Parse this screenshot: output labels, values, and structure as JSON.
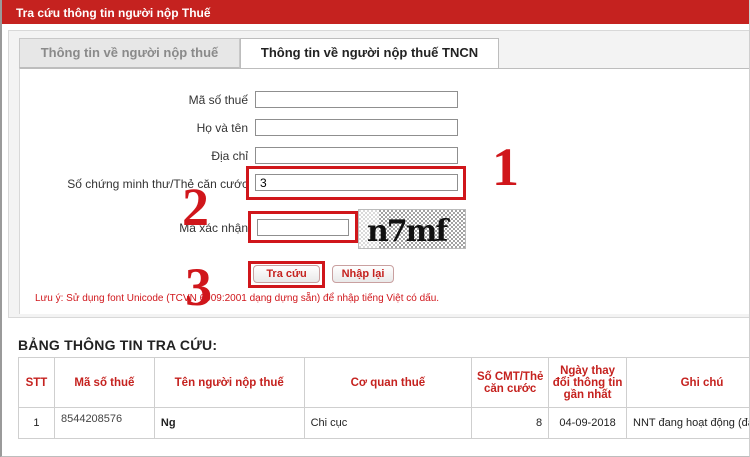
{
  "window": {
    "title": "Tra cứu thông tin người nộp Thuế"
  },
  "tabs": [
    {
      "label": "Thông tin về người nộp thuế"
    },
    {
      "label": "Thông tin về người nộp thuế TNCN"
    }
  ],
  "form": {
    "tax_code_label": "Mã số thuế",
    "tax_code_value": "",
    "name_label": "Họ và tên",
    "name_value": "",
    "address_label": "Địa chỉ",
    "address_value": "",
    "id_label": "Số chứng minh thư/Thẻ căn cước",
    "id_value": "3",
    "captcha_label": "Mã xác nhận",
    "captcha_value": "",
    "captcha_text": "n7mf",
    "search_button": "Tra cứu",
    "reset_button": "Nhập lại",
    "note": "Lưu ý: Sử dụng font Unicode (TCVN 6909:2001 dạng dựng sẵn) để nhập tiếng Việt có dấu."
  },
  "annotations": {
    "step1": "1",
    "step2": "2",
    "step3": "3",
    "color": "#d0161b"
  },
  "results": {
    "title": "BẢNG THÔNG TIN TRA CỨU:",
    "columns": [
      "STT",
      "Mã số thuế",
      "Tên người nộp thuế",
      "Cơ quan thuế",
      "Số CMT/Thẻ căn cước",
      "Ngày thay đổi thông tin gần nhất",
      "Ghi chú"
    ],
    "rows": [
      {
        "stt": "1",
        "tax_code": "8544208576",
        "name": "Ng",
        "agency": "Chi cục",
        "id_number": "8",
        "changed_date": "04-09-2018",
        "note": "NNT đang hoạt động (đã"
      }
    ]
  },
  "colors": {
    "accent": "#c5221f",
    "highlight": "#d0161b"
  }
}
